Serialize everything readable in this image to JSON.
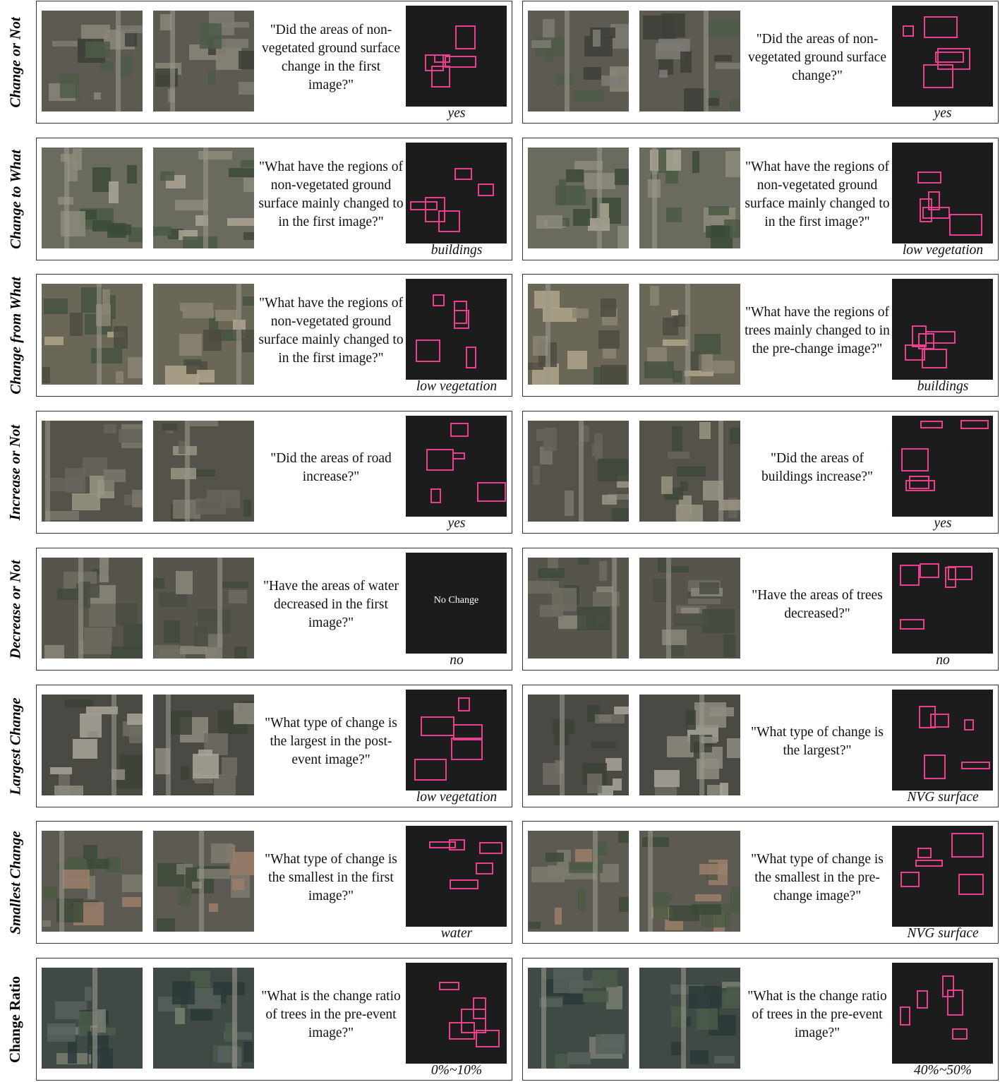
{
  "rows": [
    {
      "label": "Change or Not",
      "left": {
        "question": "\"Did the areas of non-vegetated ground surface change in the first image?\"",
        "answer": "yes",
        "mask_text": ""
      },
      "right": {
        "question": "\"Did the areas of non-vegetated ground surface change?\"",
        "answer": "yes",
        "mask_text": ""
      }
    },
    {
      "label": "Change to What",
      "left": {
        "question": "\"What have the regions of non-vegetated ground surface mainly changed to in the first image?\"",
        "answer": "buildings",
        "mask_text": ""
      },
      "right": {
        "question": "\"What have the regions of non-vegetated ground surface mainly changed to in the first image?\"",
        "answer": "low vegetation",
        "mask_text": ""
      }
    },
    {
      "label": "Change from What",
      "left": {
        "question": "\"What have the regions of non-vegetated ground surface mainly changed to in the first image?\"",
        "answer": "low vegetation",
        "mask_text": ""
      },
      "right": {
        "question": "\"What have the regions of trees mainly changed to in the pre-change image?\"",
        "answer": "buildings",
        "mask_text": ""
      }
    },
    {
      "label": "Increase or Not",
      "left": {
        "question": "\"Did the areas of road increase?\"",
        "answer": "yes",
        "mask_text": ""
      },
      "right": {
        "question": "\"Did the areas of buildings increase?\"",
        "answer": "yes",
        "mask_text": ""
      }
    },
    {
      "label": "Decrease or Not",
      "left": {
        "question": "\"Have the areas of water decreased in the first image?\"",
        "answer": "no",
        "mask_text": "No Change"
      },
      "right": {
        "question": "\"Have the areas of trees decreased?\"",
        "answer": "no",
        "mask_text": ""
      }
    },
    {
      "label": "Largest Change",
      "left": {
        "question": "\"What type of change is the largest in the post-event image?\"",
        "answer": "low vegetation",
        "mask_text": ""
      },
      "right": {
        "question": "\"What type of change is the largest?\"",
        "answer": "NVG surface",
        "mask_text": ""
      }
    },
    {
      "label": "Smallest Change",
      "left": {
        "question": "\"What type of change is the smallest in the first image?\"",
        "answer": "water",
        "mask_text": ""
      },
      "right": {
        "question": "\"What type of change is the smallest in the pre-change image?\"",
        "answer": "NVG surface",
        "mask_text": ""
      }
    },
    {
      "label": "Change Ratio",
      "left": {
        "question": "\"What is the change ratio of trees in the pre-event image?\"",
        "answer": "0%~10%",
        "mask_text": ""
      },
      "right": {
        "question": "\"What is the change ratio of trees in the pre-event image?\"",
        "answer": "40%~50%",
        "mask_text": ""
      }
    }
  ],
  "colors": {
    "mask_outline": "#e8408f",
    "mask_bg": "#1a1a1a",
    "panel_border": "#333333"
  }
}
